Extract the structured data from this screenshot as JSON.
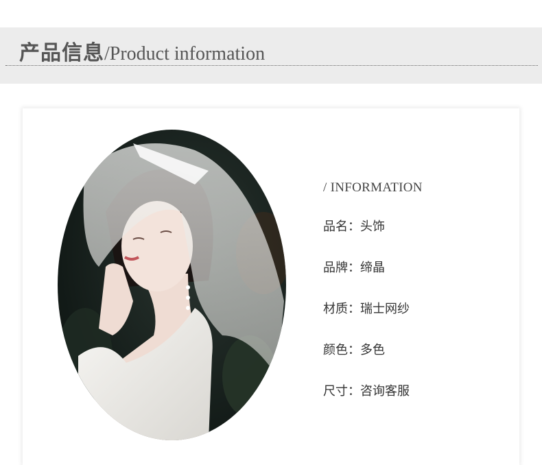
{
  "header": {
    "title_cn": "产品信息",
    "title_en": "/Product information"
  },
  "info": {
    "heading": "/ INFORMATION",
    "rows": [
      {
        "label": "品名：",
        "value": "头饰"
      },
      {
        "label": "品牌：",
        "value": "缔晶"
      },
      {
        "label": "材质：",
        "value": "瑞士网纱"
      },
      {
        "label": "颜色：",
        "value": "多色"
      },
      {
        "label": "尺寸：",
        "value": "咨询客服"
      }
    ]
  },
  "colors": {
    "header_band": "#ececec",
    "title_text": "#555555",
    "body_text": "#333333"
  }
}
